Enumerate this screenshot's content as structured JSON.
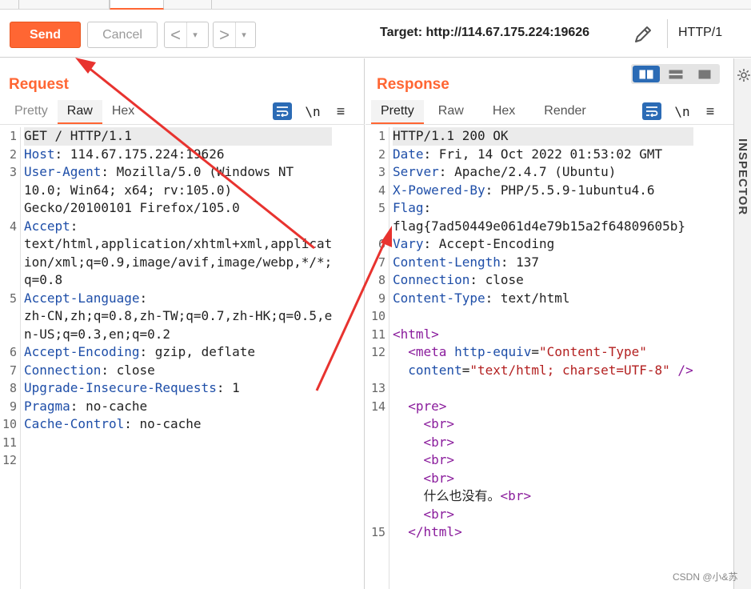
{
  "toolbar": {
    "send_label": "Send",
    "cancel_label": "Cancel",
    "back_label": "<",
    "forward_label": ">",
    "dropdown_glyph": "▾",
    "target": "Target: http://114.67.175.224:19626",
    "http_version": "HTTP/1"
  },
  "request": {
    "title": "Request",
    "tabs": [
      "Pretty",
      "Raw",
      "Hex"
    ],
    "active_tab": "Raw",
    "newline_tool": "\\n",
    "menu_tool": "≡",
    "line_numbers": [
      "1",
      "2",
      "3",
      "",
      "",
      "4",
      "",
      "",
      "",
      "5",
      "",
      "",
      "6",
      "7",
      "8",
      "9",
      "10",
      "11",
      "12"
    ],
    "lines": [
      {
        "key": "GET / HTTP/1.1",
        "rest": ""
      },
      {
        "key": "Host",
        "rest": ": 114.67.175.224:19626"
      },
      {
        "key": "User-Agent",
        "rest": ": Mozilla/5.0 (Windows NT"
      },
      {
        "key": "",
        "rest": "10.0; Win64; x64; rv:105.0)"
      },
      {
        "key": "",
        "rest": "Gecko/20100101 Firefox/105.0"
      },
      {
        "key": "Accept",
        "rest": ":"
      },
      {
        "key": "",
        "rest": "text/html,application/xhtml+xml,applicat"
      },
      {
        "key": "",
        "rest": "ion/xml;q=0.9,image/avif,image/webp,*/*;"
      },
      {
        "key": "",
        "rest": "q=0.8"
      },
      {
        "key": "Accept-Language",
        "rest": ":"
      },
      {
        "key": "",
        "rest": "zh-CN,zh;q=0.8,zh-TW;q=0.7,zh-HK;q=0.5,e"
      },
      {
        "key": "",
        "rest": "n-US;q=0.3,en;q=0.2"
      },
      {
        "key": "Accept-Encoding",
        "rest": ": gzip, deflate"
      },
      {
        "key": "Connection",
        "rest": ": close"
      },
      {
        "key": "Upgrade-Insecure-Requests",
        "rest": ": 1"
      },
      {
        "key": "Pragma",
        "rest": ": no-cache"
      },
      {
        "key": "Cache-Control",
        "rest": ": no-cache"
      },
      {
        "key": "",
        "rest": ""
      },
      {
        "key": "",
        "rest": ""
      }
    ]
  },
  "response": {
    "title": "Response",
    "tabs": [
      "Pretty",
      "Raw",
      "Hex",
      "Render"
    ],
    "active_tab": "Pretty",
    "newline_tool": "\\n",
    "menu_tool": "≡",
    "line_numbers": [
      "1",
      "2",
      "3",
      "4",
      "5",
      "",
      "6",
      "7",
      "8",
      "9",
      "10",
      "11",
      "12",
      "",
      "13",
      "14",
      "",
      "",
      "",
      "",
      "",
      "",
      "15"
    ],
    "status_line": "HTTP/1.1 200 OK",
    "headers": [
      {
        "key": "Date",
        "rest": ": Fri, 14 Oct 2022 01:53:02 GMT"
      },
      {
        "key": "Server",
        "rest": ": Apache/2.4.7 (Ubuntu)"
      },
      {
        "key": "X-Powered-By",
        "rest": ": PHP/5.5.9-1ubuntu4.6"
      },
      {
        "key": "Flag",
        "rest": ":"
      }
    ],
    "flag_value": "flag{7ad50449e061d4e79b15a2f64809605b}",
    "headers2": [
      {
        "key": "Vary",
        "rest": ": Accept-Encoding"
      },
      {
        "key": "Content-Length",
        "rest": ": 137"
      },
      {
        "key": "Connection",
        "rest": ": close"
      },
      {
        "key": "Content-Type",
        "rest": ": text/html"
      }
    ],
    "html_tag": "<html>",
    "meta_open": "<meta",
    "meta_attr1": "http-equiv",
    "meta_val1": "\"Content-Type\"",
    "meta_attr2": "content",
    "meta_val2": "\"text/html; charset=UTF-8\"",
    "meta_close": " />",
    "pre_tag": "<pre>",
    "br_tag": "<br>",
    "body_text": "什么也没有。",
    "html_close": "</html>"
  },
  "sidebar": {
    "label": "INSPECTOR"
  },
  "watermark": "CSDN @小&苏",
  "colors": {
    "accent": "#ff6633",
    "arrow": "#e8332f",
    "tool_blue": "#2b6bb5"
  }
}
